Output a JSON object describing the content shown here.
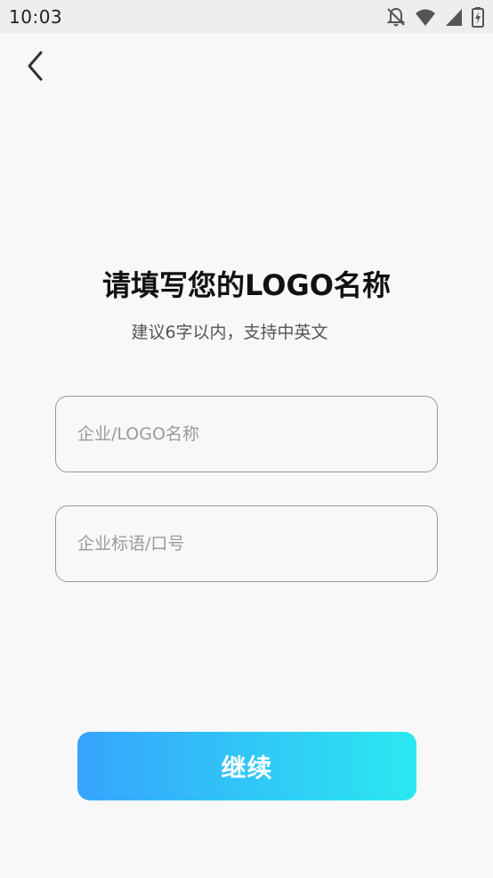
{
  "status_bar": {
    "time": "10:03",
    "icons": [
      "notifications-off-icon",
      "wifi-icon",
      "cellular-signal-icon",
      "battery-charging-icon"
    ]
  },
  "nav": {
    "back_icon": "chevron-left-icon"
  },
  "header": {
    "title": "请填写您的LOGO名称",
    "subtitle": "建议6字以内，支持中英文"
  },
  "form": {
    "company_name_placeholder": "企业/LOGO名称",
    "company_name_value": "",
    "slogan_placeholder": "企业标语/口号",
    "slogan_value": ""
  },
  "actions": {
    "continue_label": "继续"
  },
  "colors": {
    "background": "#f8f8f8",
    "button_gradient_start": "#36a4fd",
    "button_gradient_end": "#2be8f1",
    "field_border": "#999999"
  }
}
